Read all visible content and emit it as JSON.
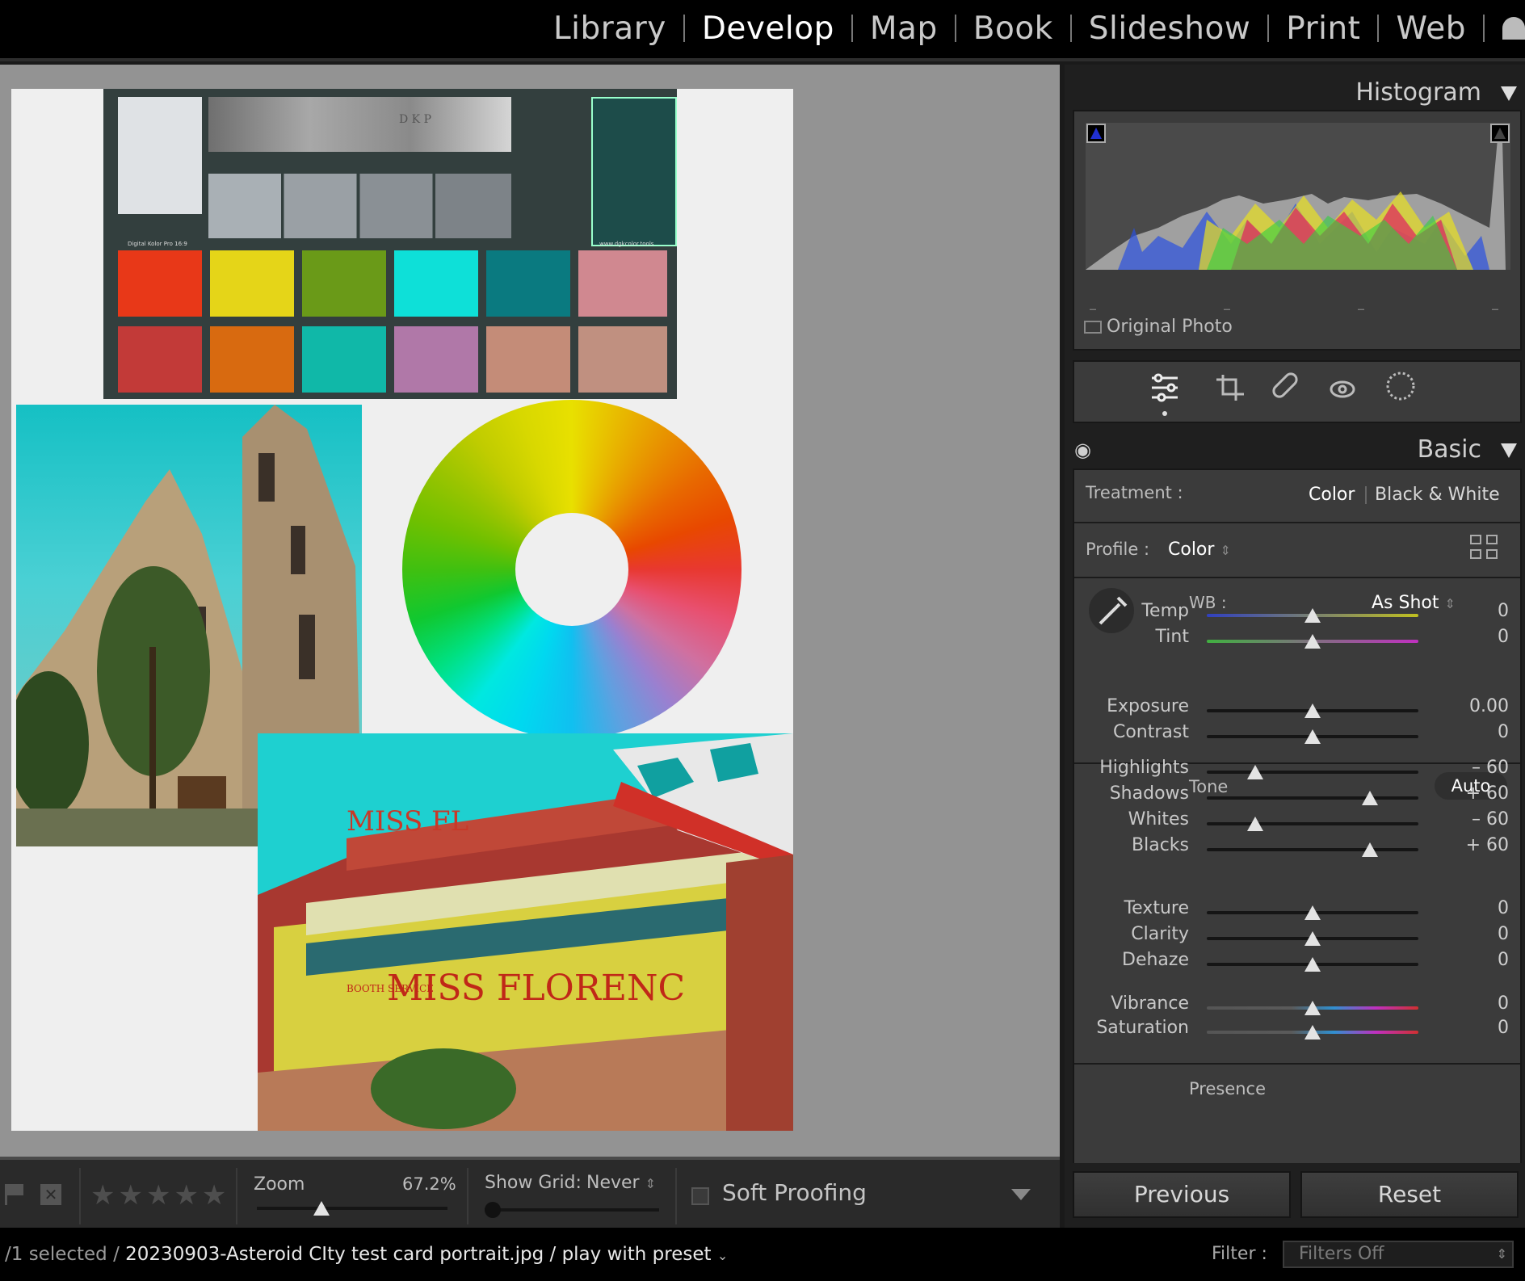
{
  "modules": [
    "Library",
    "Develop",
    "Map",
    "Book",
    "Slideshow",
    "Print",
    "Web"
  ],
  "active_module": "Develop",
  "histogram": {
    "title": "Histogram",
    "original_photo": "Original Photo"
  },
  "basic": {
    "title": "Basic",
    "treatment_label": "Treatment :",
    "treatment_color": "Color",
    "treatment_bw": "Black & White",
    "profile_label": "Profile :",
    "profile_value": "Color",
    "wb_label": "WB :",
    "wb_value": "As Shot",
    "tone_label": "Tone",
    "auto_label": "Auto",
    "presence_label": "Presence",
    "sliders": [
      {
        "label": "Temp",
        "value": "0",
        "pos": 0.5
      },
      {
        "label": "Tint",
        "value": "0",
        "pos": 0.5
      },
      {
        "label": "Exposure",
        "value": "0.00",
        "pos": 0.5
      },
      {
        "label": "Contrast",
        "value": "0",
        "pos": 0.5
      },
      {
        "label": "Highlights",
        "value": "– 60",
        "pos": 0.23
      },
      {
        "label": "Shadows",
        "value": "+ 60",
        "pos": 0.77
      },
      {
        "label": "Whites",
        "value": "– 60",
        "pos": 0.23
      },
      {
        "label": "Blacks",
        "value": "+ 60",
        "pos": 0.77
      },
      {
        "label": "Texture",
        "value": "0",
        "pos": 0.5
      },
      {
        "label": "Clarity",
        "value": "0",
        "pos": 0.5
      },
      {
        "label": "Dehaze",
        "value": "0",
        "pos": 0.5
      },
      {
        "label": "Vibrance",
        "value": "0",
        "pos": 0.5
      },
      {
        "label": "Saturation",
        "value": "0",
        "pos": 0.5
      }
    ]
  },
  "buttons": {
    "previous": "Previous",
    "reset": "Reset"
  },
  "toolbar": {
    "zoom_label": "Zoom",
    "zoom_value": "67.2%",
    "zoom_pos": 0.34,
    "grid_label": "Show Grid:",
    "grid_value": "Never",
    "soft_proofing": "Soft Proofing"
  },
  "status": {
    "selected": "/1 selected /",
    "filename": "20230903-Asteroid CIty test card portrait.jpg / play with preset",
    "filter_label": "Filter :",
    "filter_value": "Filters Off"
  },
  "image_text": {
    "checker_brand": "Digital Kolor Pro 16:9",
    "checker_url": "www.dgkcolor.tools",
    "dkp": "D K P",
    "diner_sign": "MISS FLORENC",
    "diner_small": "BOOTH SERVICE",
    "diner_top": "MISS FL"
  },
  "colors": {
    "accent_white": "#ffffff",
    "panel_bg": "#3b3b3b",
    "shadow_clip": "#2030d0"
  }
}
